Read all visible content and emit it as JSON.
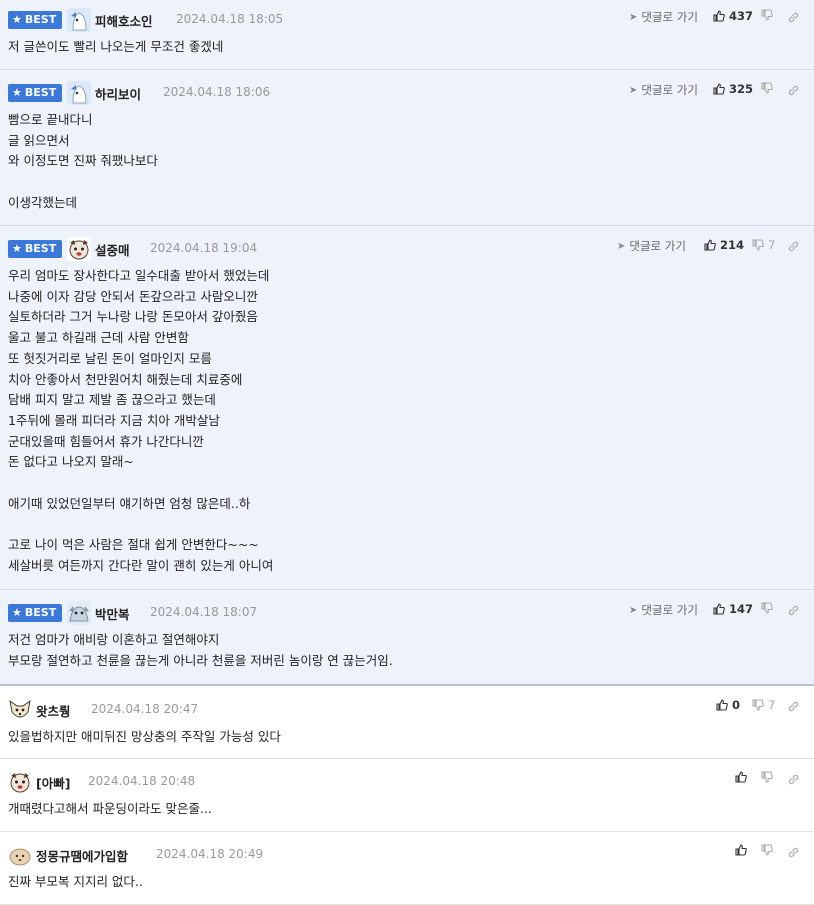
{
  "labels": {
    "best": "BEST",
    "reply": "댓글로 가기"
  },
  "comments": [
    {
      "nickname": "피해호소인",
      "date": "2024.04.18 18:05",
      "up": "437",
      "down": "",
      "text": "저 글쓴이도 빨리 나오는게 무조건 좋겠네"
    },
    {
      "nickname": "하리보이",
      "date": "2024.04.18 18:06",
      "up": "325",
      "down": "",
      "text": "빰으로 끝내다니\n글 읽으면서\n와 이정도면 진짜 줘팼나보다\n\n이생각했는데"
    },
    {
      "nickname": "설중매",
      "date": "2024.04.18 19:04",
      "up": "214",
      "down": "7",
      "text": "우리 엄마도 장사한다고 일수대출 받아서 했었는데\n나중에 이자 감당 안되서 돈갚으라고 사람오니깐\n실토하더라 그거 누나랑 나랑 돈모아서 갚아줬음\n울고 불고 하길래 근데 사람 안변함\n또 헛짓거리로 날린 돈이 얼마인지 모름\n치아 안좋아서 천만원어치 해줬는데 치료중에\n담배 피지 말고 제발 좀 끊으라고 했는데\n1주뒤에 몰래 피더라 지금 치아 개박살남\n군대있을때 힘들어서 휴가 나간다니깐\n돈 없다고 나오지 말래~\n\n애기때 있었던일부터 얘기하면 엄청 많은데..하\n\n고로 나이 먹은 사람은 절대 쉽게 안변한다~~~\n세살버릇 여든까지 간다란 말이 괜히 있는게 아니여"
    },
    {
      "nickname": "박만복",
      "date": "2024.04.18 18:07",
      "up": "147",
      "down": "",
      "text": "저건 엄마가 애비랑 이혼하고 절연해야지\n부모랑 절연하고 천륜을 끊는게 아니라 천륜을 저버린 놈이랑 연 끊는거임."
    },
    {
      "nickname": "왓츠뤙",
      "date": "2024.04.18 20:47",
      "up": "0",
      "down": "7",
      "text": "있을법하지만 애미뒤진 망상충의 주작일 가능성 있다"
    },
    {
      "nickname": "[아빠]",
      "date": "2024.04.18 20:48",
      "up": "",
      "down": "",
      "text": "개때렸다고해서 파운딩이라도 맞은줄..."
    },
    {
      "nickname": "정몽규땜에가입함",
      "date": "2024.04.18 20:49",
      "up": "",
      "down": "",
      "text": "진짜 부모복 지지리 없다.."
    }
  ],
  "icons": {
    "best_badge": "star-icon",
    "reply": "arrow-icon",
    "upvote": "thumbs-up-icon",
    "downvote": "thumbs-down-icon",
    "more": "link-icon"
  },
  "colors": {
    "best_bg": "#eef2fb",
    "badge": "#3c78d8",
    "date": "#999999"
  }
}
